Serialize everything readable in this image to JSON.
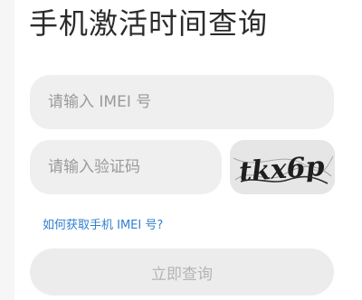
{
  "header": {
    "title": "手机激活时间查询"
  },
  "form": {
    "imei_placeholder": "请输入 IMEI 号",
    "code_placeholder": "请输入验证码",
    "captcha_text": "tkx6p",
    "help_link": "如何获取手机 IMEI 号?",
    "submit_label": "立即查询"
  },
  "colors": {
    "link": "#2f7fd1",
    "field_bg": "#efefef",
    "button_bg": "#ececec",
    "button_text": "#b4b4b4"
  }
}
